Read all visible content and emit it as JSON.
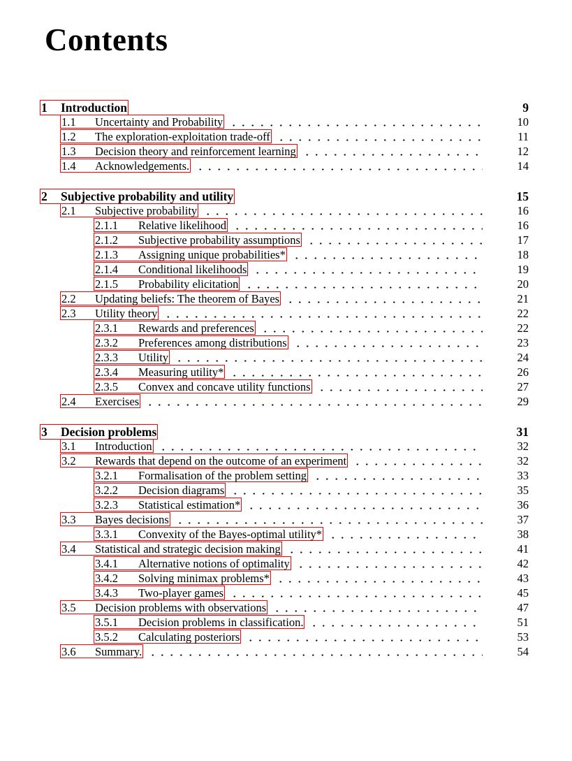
{
  "document": {
    "title": "Contents"
  },
  "colors": {
    "link_box": "#ff0000",
    "text": "#000000",
    "page_background": "#ffffff"
  },
  "toc": {
    "entries": [
      {
        "level": "chapter",
        "number": "1",
        "title": "Introduction",
        "page": "9",
        "gap_before": false
      },
      {
        "level": "section",
        "number": "1.1",
        "title": "Uncertainty and Probability",
        "page": "10",
        "gap_before": false
      },
      {
        "level": "section",
        "number": "1.2",
        "title": "The exploration-exploitation trade-off",
        "page": "11",
        "gap_before": false
      },
      {
        "level": "section",
        "number": "1.3",
        "title": "Decision theory and reinforcement learning",
        "page": "12",
        "gap_before": false
      },
      {
        "level": "section",
        "number": "1.4",
        "title": "Acknowledgements.",
        "page": "14",
        "gap_before": false
      },
      {
        "level": "chapter",
        "number": "2",
        "title": "Subjective probability and utility",
        "page": "15",
        "gap_before": true
      },
      {
        "level": "section",
        "number": "2.1",
        "title": "Subjective probability",
        "page": "16",
        "gap_before": false
      },
      {
        "level": "subsection",
        "number": "2.1.1",
        "title": "Relative likelihood",
        "page": "16",
        "gap_before": false
      },
      {
        "level": "subsection",
        "number": "2.1.2",
        "title": "Subjective probability assumptions",
        "page": "17",
        "gap_before": false
      },
      {
        "level": "subsection",
        "number": "2.1.3",
        "title": "Assigning unique probabilities*",
        "page": "18",
        "gap_before": false
      },
      {
        "level": "subsection",
        "number": "2.1.4",
        "title": "Conditional likelihoods",
        "page": "19",
        "gap_before": false
      },
      {
        "level": "subsection",
        "number": "2.1.5",
        "title": "Probability elicitation",
        "page": "20",
        "gap_before": false
      },
      {
        "level": "section",
        "number": "2.2",
        "title": "Updating beliefs: The theorem of Bayes",
        "page": "21",
        "gap_before": false
      },
      {
        "level": "section",
        "number": "2.3",
        "title": "Utility theory",
        "page": "22",
        "gap_before": false
      },
      {
        "level": "subsection",
        "number": "2.3.1",
        "title": "Rewards and preferences",
        "page": "22",
        "gap_before": false
      },
      {
        "level": "subsection",
        "number": "2.3.2",
        "title": "Preferences among distributions",
        "page": "23",
        "gap_before": false
      },
      {
        "level": "subsection",
        "number": "2.3.3",
        "title": "Utility",
        "page": "24",
        "gap_before": false
      },
      {
        "level": "subsection",
        "number": "2.3.4",
        "title": "Measuring utility*",
        "page": "26",
        "gap_before": false
      },
      {
        "level": "subsection",
        "number": "2.3.5",
        "title": "Convex and concave utility functions",
        "page": "27",
        "gap_before": false
      },
      {
        "level": "section",
        "number": "2.4",
        "title": "Exercises",
        "page": "29",
        "gap_before": false
      },
      {
        "level": "chapter",
        "number": "3",
        "title": "Decision problems",
        "page": "31",
        "gap_before": true
      },
      {
        "level": "section",
        "number": "3.1",
        "title": "Introduction",
        "page": "32",
        "gap_before": false
      },
      {
        "level": "section",
        "number": "3.2",
        "title": "Rewards that depend on the outcome of an experiment",
        "page": "32",
        "gap_before": false
      },
      {
        "level": "subsection",
        "number": "3.2.1",
        "title": "Formalisation of the problem setting",
        "page": "33",
        "gap_before": false
      },
      {
        "level": "subsection",
        "number": "3.2.2",
        "title": "Decision diagrams",
        "page": "35",
        "gap_before": false
      },
      {
        "level": "subsection",
        "number": "3.2.3",
        "title": "Statistical estimation*",
        "page": "36",
        "gap_before": false
      },
      {
        "level": "section",
        "number": "3.3",
        "title": "Bayes decisions",
        "page": "37",
        "gap_before": false
      },
      {
        "level": "subsection",
        "number": "3.3.1",
        "title": "Convexity of the Bayes-optimal utility*",
        "page": "38",
        "gap_before": false
      },
      {
        "level": "section",
        "number": "3.4",
        "title": "Statistical and strategic decision making",
        "page": "41",
        "gap_before": false
      },
      {
        "level": "subsection",
        "number": "3.4.1",
        "title": "Alternative notions of optimality",
        "page": "42",
        "gap_before": false
      },
      {
        "level": "subsection",
        "number": "3.4.2",
        "title": "Solving minimax problems*",
        "page": "43",
        "gap_before": false
      },
      {
        "level": "subsection",
        "number": "3.4.3",
        "title": "Two-player games",
        "page": "45",
        "gap_before": false
      },
      {
        "level": "section",
        "number": "3.5",
        "title": "Decision problems with observations",
        "page": "47",
        "gap_before": false
      },
      {
        "level": "subsection",
        "number": "3.5.1",
        "title": "Decision problems in classification.",
        "page": "51",
        "gap_before": false
      },
      {
        "level": "subsection",
        "number": "3.5.2",
        "title": "Calculating posteriors",
        "page": "53",
        "gap_before": false
      },
      {
        "level": "section",
        "number": "3.6",
        "title": "Summary.",
        "page": "54",
        "gap_before": false
      }
    ]
  }
}
